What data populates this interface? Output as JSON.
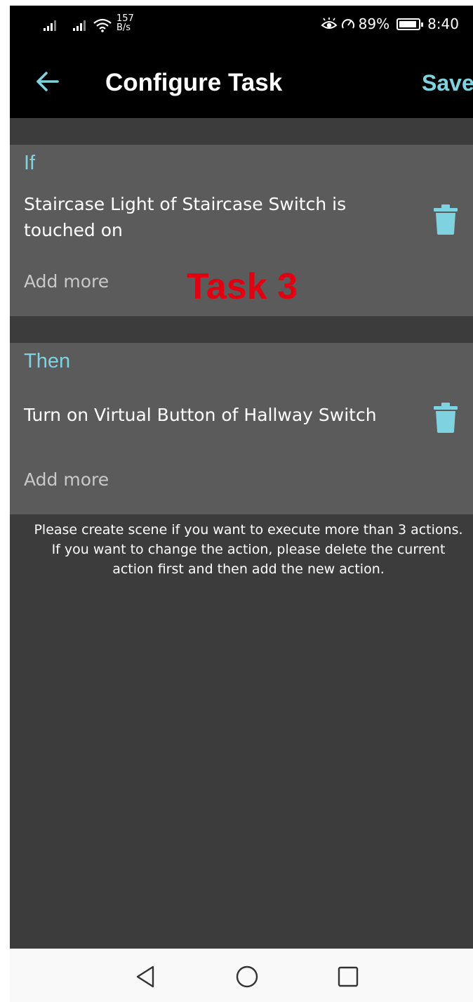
{
  "status_bar": {
    "net_speed_value": "157",
    "net_speed_unit": "B/s",
    "battery": "89%",
    "time": "8:40",
    "icons": [
      "signal-icon",
      "signal-icon",
      "wifi-icon",
      "eye-icon",
      "speed-icon",
      "battery-icon"
    ]
  },
  "app_bar": {
    "title": "Configure Task",
    "save_label": "Save"
  },
  "if_section": {
    "heading": "If",
    "condition": "Staircase Light of Staircase Switch is touched on",
    "add_more": "Add more"
  },
  "overlay": {
    "task_label": "Task 3"
  },
  "then_section": {
    "heading": "Then",
    "action": "Turn on Virtual Button of Hallway Switch",
    "add_more": "Add more"
  },
  "info": {
    "text": "Please create scene if you want to execute more than 3 actions. If you want to change the action, please delete the current action first and then add the new action."
  },
  "colors": {
    "accent": "#7fd3e0",
    "annotation": "#e0000f",
    "section_bg": "#5b5b5b",
    "page_bg": "#3c3c3c"
  },
  "nav_bar": {
    "icons": [
      "back-triangle-icon",
      "home-circle-icon",
      "recents-square-icon"
    ]
  }
}
